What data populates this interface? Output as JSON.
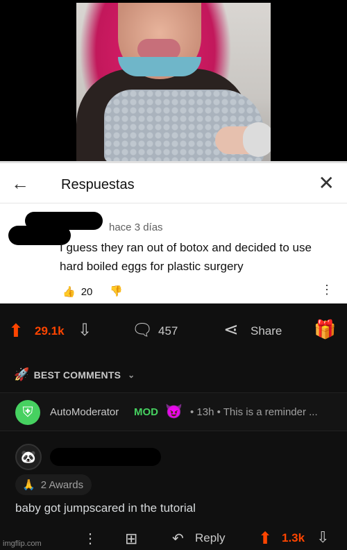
{
  "youtube_panel": {
    "title": "Respuestas",
    "comment": {
      "time": "hace 3 días",
      "text": "I guess they ran out of botox and decided to use hard boiled eggs for plastic surgery",
      "likes": "20"
    }
  },
  "reddit": {
    "post_actions": {
      "score": "29.1k",
      "comments": "457",
      "share_label": "Share"
    },
    "sort_label": "BEST COMMENTS",
    "automod": {
      "name": "AutoModerator",
      "mod_tag": "MOD",
      "meta": "• 13h • This is a reminder ..."
    },
    "comment": {
      "awards": "2 Awards",
      "text": "baby got jumpscared in the tutorial",
      "reply_label": "Reply",
      "score": "1.3k"
    },
    "accent_color": "#ff4500",
    "mod_color": "#46d160"
  },
  "watermark": "imgflip.com"
}
